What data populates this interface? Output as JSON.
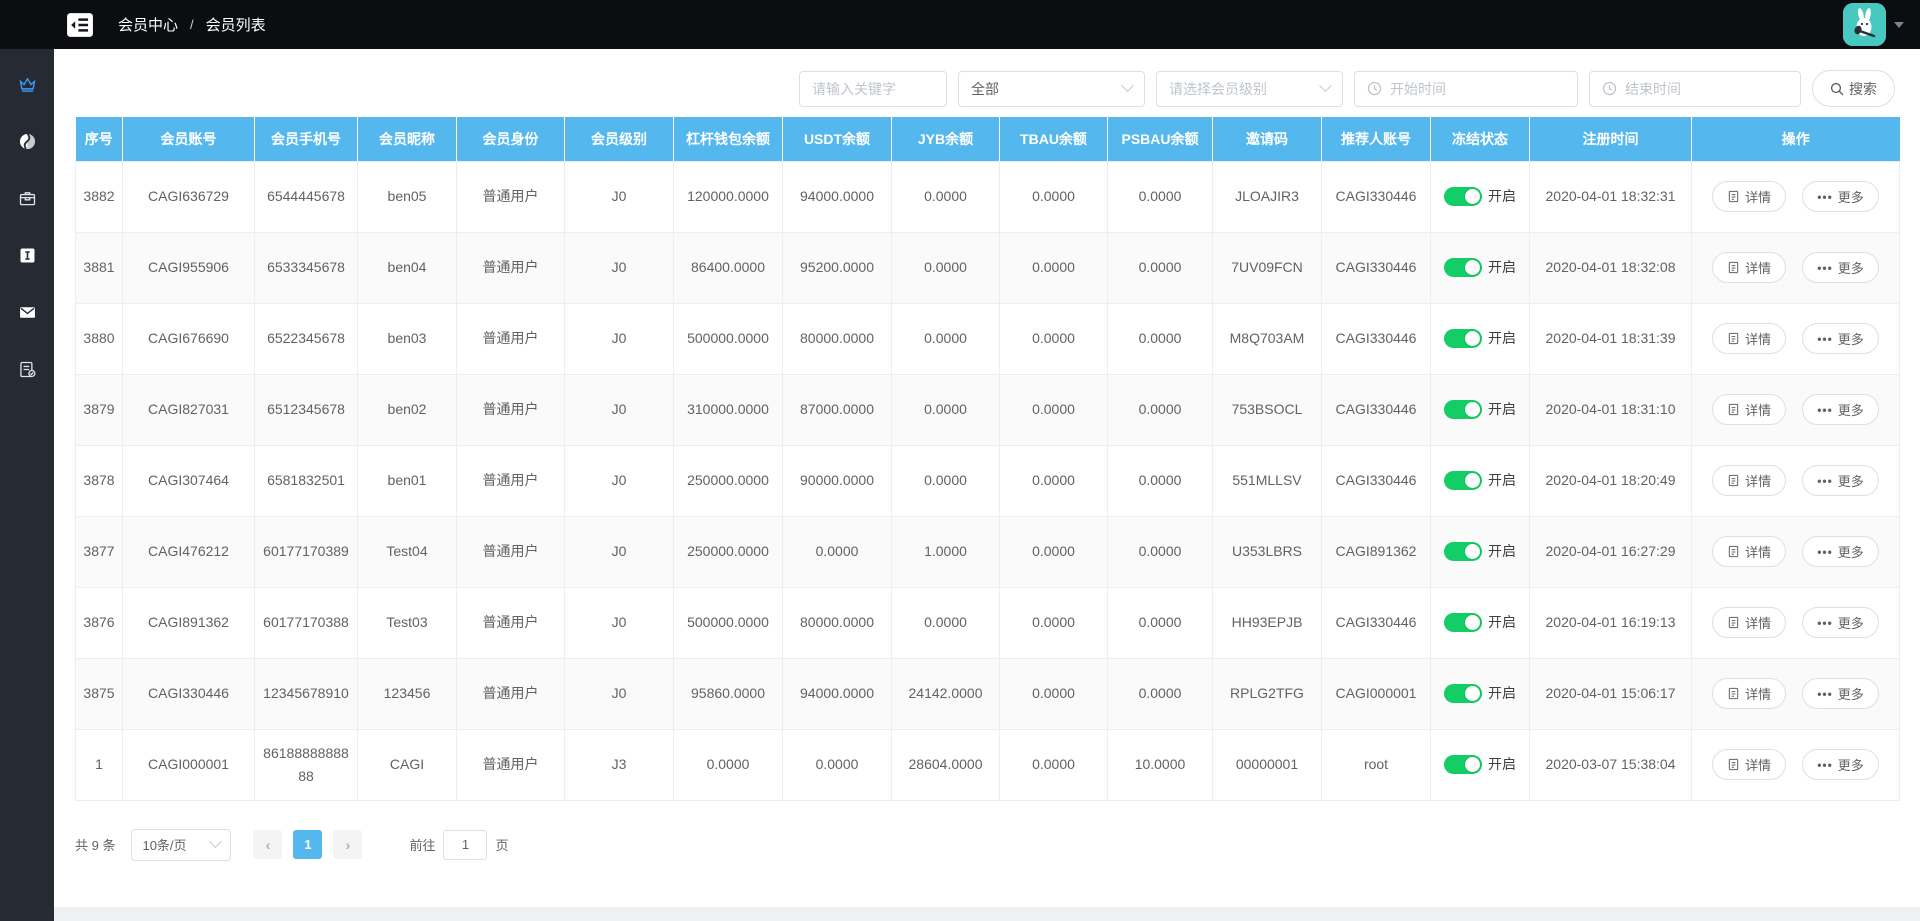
{
  "topbar": {
    "breadcrumb": [
      {
        "label": "会员中心"
      },
      {
        "label": "会员列表"
      }
    ],
    "separator": "/"
  },
  "sidebar": {
    "items": [
      {
        "icon": "home-icon",
        "active": false
      },
      {
        "icon": "crown-icon",
        "active": true
      },
      {
        "icon": "globe-icon",
        "active": false
      },
      {
        "icon": "toolbox-icon",
        "active": false
      },
      {
        "icon": "info-square-icon",
        "active": false
      },
      {
        "icon": "mail-icon",
        "active": false
      },
      {
        "icon": "file-check-icon",
        "active": false
      }
    ]
  },
  "filters": {
    "keyword_placeholder": "请输入关键字",
    "identity_value": "全部",
    "level_placeholder": "请选择会员级别",
    "start_placeholder": "开始时间",
    "end_placeholder": "结束时间",
    "search_label": "搜索"
  },
  "table": {
    "columns": [
      "序号",
      "会员账号",
      "会员手机号",
      "会员昵称",
      "会员身份",
      "会员级别",
      "杠杆钱包余额",
      "USDT余额",
      "JYB余额",
      "TBAU余额",
      "PSBAU余额",
      "邀请码",
      "推荐人账号",
      "冻结状态",
      "注册时间",
      "操作"
    ],
    "rows": [
      {
        "seq": "3882",
        "account": "CAGI636729",
        "phone": "6544445678",
        "nickname": "ben05",
        "identity": "普通用户",
        "level": "J0",
        "lever_balance": "120000.0000",
        "usdt_balance": "94000.0000",
        "jyb_balance": "0.0000",
        "tbau_balance": "0.0000",
        "psbau_balance": "0.0000",
        "invite_code": "JLOAJIR3",
        "referrer": "CAGI330446",
        "status": "开启",
        "reg_time": "2020-04-01 18:32:31"
      },
      {
        "seq": "3881",
        "account": "CAGI955906",
        "phone": "6533345678",
        "nickname": "ben04",
        "identity": "普通用户",
        "level": "J0",
        "lever_balance": "86400.0000",
        "usdt_balance": "95200.0000",
        "jyb_balance": "0.0000",
        "tbau_balance": "0.0000",
        "psbau_balance": "0.0000",
        "invite_code": "7UV09FCN",
        "referrer": "CAGI330446",
        "status": "开启",
        "reg_time": "2020-04-01 18:32:08"
      },
      {
        "seq": "3880",
        "account": "CAGI676690",
        "phone": "6522345678",
        "nickname": "ben03",
        "identity": "普通用户",
        "level": "J0",
        "lever_balance": "500000.0000",
        "usdt_balance": "80000.0000",
        "jyb_balance": "0.0000",
        "tbau_balance": "0.0000",
        "psbau_balance": "0.0000",
        "invite_code": "M8Q703AM",
        "referrer": "CAGI330446",
        "status": "开启",
        "reg_time": "2020-04-01 18:31:39"
      },
      {
        "seq": "3879",
        "account": "CAGI827031",
        "phone": "6512345678",
        "nickname": "ben02",
        "identity": "普通用户",
        "level": "J0",
        "lever_balance": "310000.0000",
        "usdt_balance": "87000.0000",
        "jyb_balance": "0.0000",
        "tbau_balance": "0.0000",
        "psbau_balance": "0.0000",
        "invite_code": "753BSOCL",
        "referrer": "CAGI330446",
        "status": "开启",
        "reg_time": "2020-04-01 18:31:10"
      },
      {
        "seq": "3878",
        "account": "CAGI307464",
        "phone": "6581832501",
        "nickname": "ben01",
        "identity": "普通用户",
        "level": "J0",
        "lever_balance": "250000.0000",
        "usdt_balance": "90000.0000",
        "jyb_balance": "0.0000",
        "tbau_balance": "0.0000",
        "psbau_balance": "0.0000",
        "invite_code": "551MLLSV",
        "referrer": "CAGI330446",
        "status": "开启",
        "reg_time": "2020-04-01 18:20:49"
      },
      {
        "seq": "3877",
        "account": "CAGI476212",
        "phone": "60177170389",
        "nickname": "Test04",
        "identity": "普通用户",
        "level": "J0",
        "lever_balance": "250000.0000",
        "usdt_balance": "0.0000",
        "jyb_balance": "1.0000",
        "tbau_balance": "0.0000",
        "psbau_balance": "0.0000",
        "invite_code": "U353LBRS",
        "referrer": "CAGI891362",
        "status": "开启",
        "reg_time": "2020-04-01 16:27:29"
      },
      {
        "seq": "3876",
        "account": "CAGI891362",
        "phone": "60177170388",
        "nickname": "Test03",
        "identity": "普通用户",
        "level": "J0",
        "lever_balance": "500000.0000",
        "usdt_balance": "80000.0000",
        "jyb_balance": "0.0000",
        "tbau_balance": "0.0000",
        "psbau_balance": "0.0000",
        "invite_code": "HH93EPJB",
        "referrer": "CAGI330446",
        "status": "开启",
        "reg_time": "2020-04-01 16:19:13"
      },
      {
        "seq": "3875",
        "account": "CAGI330446",
        "phone": "12345678910",
        "nickname": "123456",
        "identity": "普通用户",
        "level": "J0",
        "lever_balance": "95860.0000",
        "usdt_balance": "94000.0000",
        "jyb_balance": "24142.0000",
        "tbau_balance": "0.0000",
        "psbau_balance": "0.0000",
        "invite_code": "RPLG2TFG",
        "referrer": "CAGI000001",
        "status": "开启",
        "reg_time": "2020-04-01 15:06:17"
      },
      {
        "seq": "1",
        "account": "CAGI000001",
        "phone": "8618888888888",
        "nickname": "CAGI",
        "identity": "普通用户",
        "level": "J3",
        "lever_balance": "0.0000",
        "usdt_balance": "0.0000",
        "jyb_balance": "28604.0000",
        "tbau_balance": "0.0000",
        "psbau_balance": "10.0000",
        "invite_code": "00000001",
        "referrer": "root",
        "status": "开启",
        "reg_time": "2020-03-07 15:38:04"
      }
    ]
  },
  "actions": {
    "detail": "详情",
    "more": "更多"
  },
  "pagination": {
    "total_text": "共 9 条",
    "page_size": "10条/页",
    "current_page": "1",
    "goto_prefix": "前往",
    "goto_value": "1",
    "goto_suffix": "页"
  },
  "colors": {
    "header_blue": "#54b8ef",
    "toggle_green": "#13ce66",
    "avatar_teal": "#47c9c1",
    "sidebar_bg": "#262a33",
    "topbar_bg": "#0b0d10"
  }
}
